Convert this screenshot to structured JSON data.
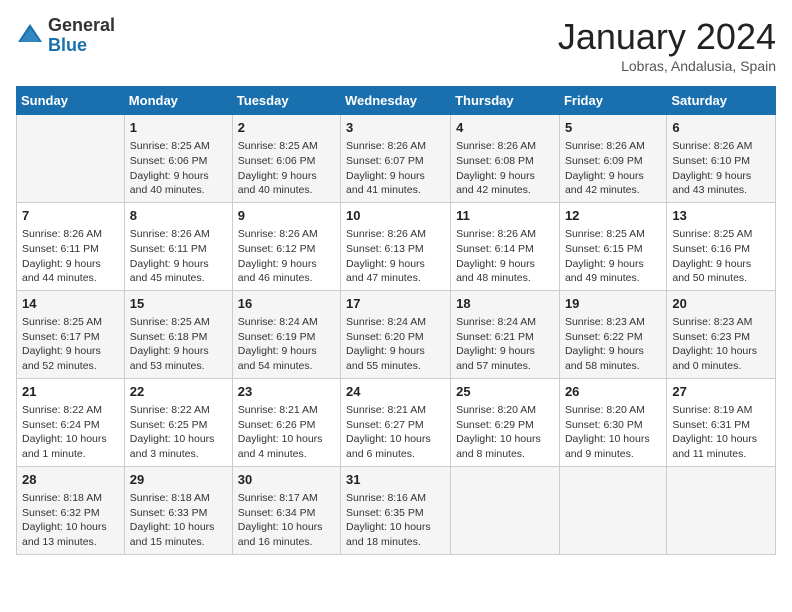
{
  "header": {
    "logo_general": "General",
    "logo_blue": "Blue",
    "month_title": "January 2024",
    "subtitle": "Lobras, Andalusia, Spain"
  },
  "columns": [
    "Sunday",
    "Monday",
    "Tuesday",
    "Wednesday",
    "Thursday",
    "Friday",
    "Saturday"
  ],
  "weeks": [
    [
      {
        "day": "",
        "info": ""
      },
      {
        "day": "1",
        "info": "Sunrise: 8:25 AM\nSunset: 6:06 PM\nDaylight: 9 hours\nand 40 minutes."
      },
      {
        "day": "2",
        "info": "Sunrise: 8:25 AM\nSunset: 6:06 PM\nDaylight: 9 hours\nand 40 minutes."
      },
      {
        "day": "3",
        "info": "Sunrise: 8:26 AM\nSunset: 6:07 PM\nDaylight: 9 hours\nand 41 minutes."
      },
      {
        "day": "4",
        "info": "Sunrise: 8:26 AM\nSunset: 6:08 PM\nDaylight: 9 hours\nand 42 minutes."
      },
      {
        "day": "5",
        "info": "Sunrise: 8:26 AM\nSunset: 6:09 PM\nDaylight: 9 hours\nand 42 minutes."
      },
      {
        "day": "6",
        "info": "Sunrise: 8:26 AM\nSunset: 6:10 PM\nDaylight: 9 hours\nand 43 minutes."
      }
    ],
    [
      {
        "day": "7",
        "info": "Sunrise: 8:26 AM\nSunset: 6:11 PM\nDaylight: 9 hours\nand 44 minutes."
      },
      {
        "day": "8",
        "info": "Sunrise: 8:26 AM\nSunset: 6:11 PM\nDaylight: 9 hours\nand 45 minutes."
      },
      {
        "day": "9",
        "info": "Sunrise: 8:26 AM\nSunset: 6:12 PM\nDaylight: 9 hours\nand 46 minutes."
      },
      {
        "day": "10",
        "info": "Sunrise: 8:26 AM\nSunset: 6:13 PM\nDaylight: 9 hours\nand 47 minutes."
      },
      {
        "day": "11",
        "info": "Sunrise: 8:26 AM\nSunset: 6:14 PM\nDaylight: 9 hours\nand 48 minutes."
      },
      {
        "day": "12",
        "info": "Sunrise: 8:25 AM\nSunset: 6:15 PM\nDaylight: 9 hours\nand 49 minutes."
      },
      {
        "day": "13",
        "info": "Sunrise: 8:25 AM\nSunset: 6:16 PM\nDaylight: 9 hours\nand 50 minutes."
      }
    ],
    [
      {
        "day": "14",
        "info": "Sunrise: 8:25 AM\nSunset: 6:17 PM\nDaylight: 9 hours\nand 52 minutes."
      },
      {
        "day": "15",
        "info": "Sunrise: 8:25 AM\nSunset: 6:18 PM\nDaylight: 9 hours\nand 53 minutes."
      },
      {
        "day": "16",
        "info": "Sunrise: 8:24 AM\nSunset: 6:19 PM\nDaylight: 9 hours\nand 54 minutes."
      },
      {
        "day": "17",
        "info": "Sunrise: 8:24 AM\nSunset: 6:20 PM\nDaylight: 9 hours\nand 55 minutes."
      },
      {
        "day": "18",
        "info": "Sunrise: 8:24 AM\nSunset: 6:21 PM\nDaylight: 9 hours\nand 57 minutes."
      },
      {
        "day": "19",
        "info": "Sunrise: 8:23 AM\nSunset: 6:22 PM\nDaylight: 9 hours\nand 58 minutes."
      },
      {
        "day": "20",
        "info": "Sunrise: 8:23 AM\nSunset: 6:23 PM\nDaylight: 10 hours\nand 0 minutes."
      }
    ],
    [
      {
        "day": "21",
        "info": "Sunrise: 8:22 AM\nSunset: 6:24 PM\nDaylight: 10 hours\nand 1 minute."
      },
      {
        "day": "22",
        "info": "Sunrise: 8:22 AM\nSunset: 6:25 PM\nDaylight: 10 hours\nand 3 minutes."
      },
      {
        "day": "23",
        "info": "Sunrise: 8:21 AM\nSunset: 6:26 PM\nDaylight: 10 hours\nand 4 minutes."
      },
      {
        "day": "24",
        "info": "Sunrise: 8:21 AM\nSunset: 6:27 PM\nDaylight: 10 hours\nand 6 minutes."
      },
      {
        "day": "25",
        "info": "Sunrise: 8:20 AM\nSunset: 6:29 PM\nDaylight: 10 hours\nand 8 minutes."
      },
      {
        "day": "26",
        "info": "Sunrise: 8:20 AM\nSunset: 6:30 PM\nDaylight: 10 hours\nand 9 minutes."
      },
      {
        "day": "27",
        "info": "Sunrise: 8:19 AM\nSunset: 6:31 PM\nDaylight: 10 hours\nand 11 minutes."
      }
    ],
    [
      {
        "day": "28",
        "info": "Sunrise: 8:18 AM\nSunset: 6:32 PM\nDaylight: 10 hours\nand 13 minutes."
      },
      {
        "day": "29",
        "info": "Sunrise: 8:18 AM\nSunset: 6:33 PM\nDaylight: 10 hours\nand 15 minutes."
      },
      {
        "day": "30",
        "info": "Sunrise: 8:17 AM\nSunset: 6:34 PM\nDaylight: 10 hours\nand 16 minutes."
      },
      {
        "day": "31",
        "info": "Sunrise: 8:16 AM\nSunset: 6:35 PM\nDaylight: 10 hours\nand 18 minutes."
      },
      {
        "day": "",
        "info": ""
      },
      {
        "day": "",
        "info": ""
      },
      {
        "day": "",
        "info": ""
      }
    ]
  ]
}
